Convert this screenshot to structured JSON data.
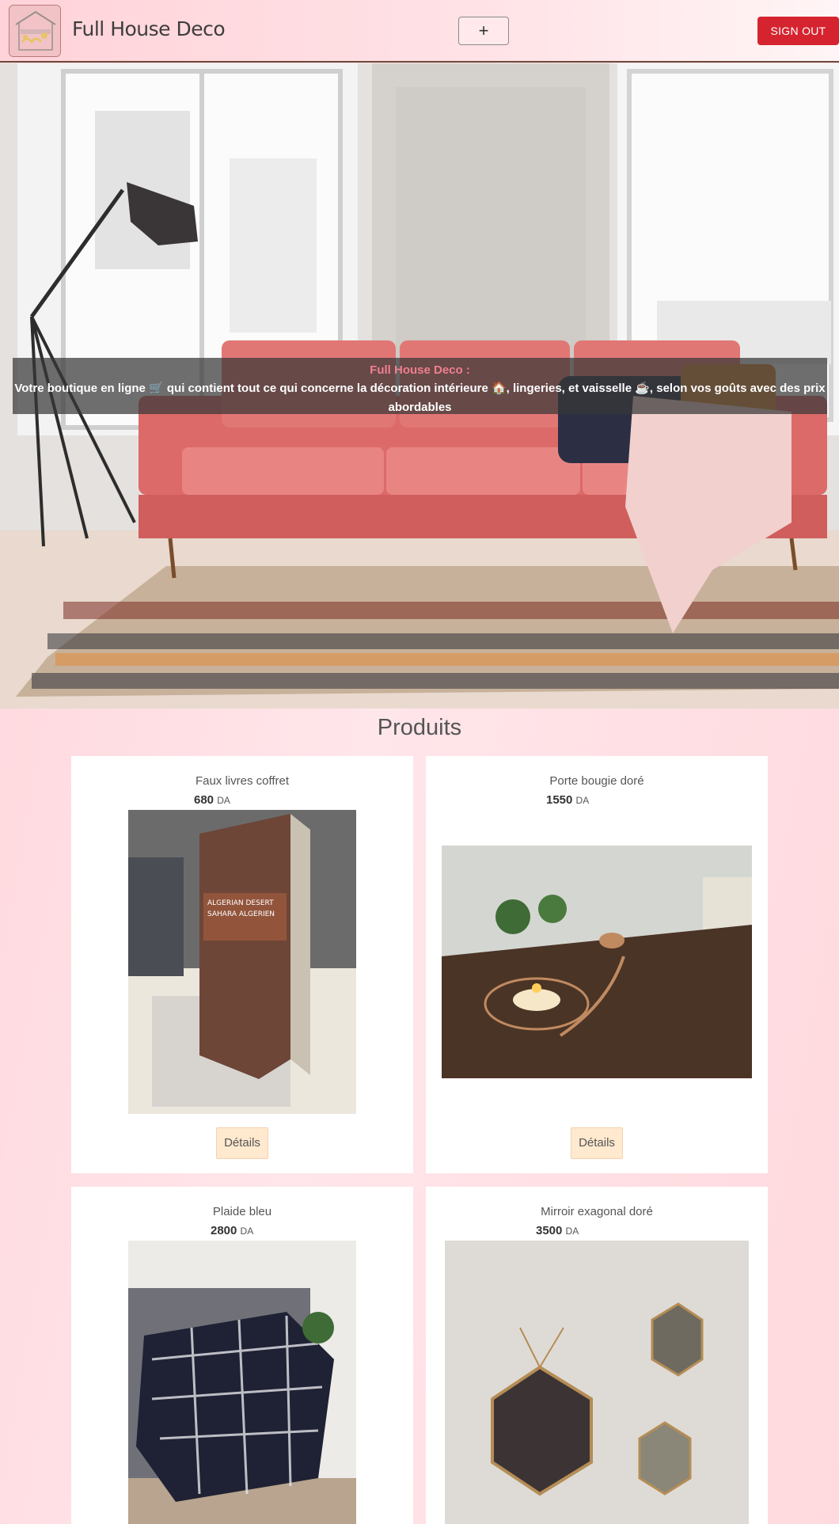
{
  "header": {
    "brand": "Full House Deco",
    "add_label": "+",
    "signout_label": "SIGN OUT"
  },
  "hero": {
    "title": "Full House Deco :",
    "text": "Votre boutique en ligne 🛒 qui contient tout ce qui concerne la décoration intérieure 🏠, lingeries, et vaisselle ☕, selon vos goûts avec des prix abordables"
  },
  "products": {
    "title": "Produits",
    "details_label": "Détails",
    "currency": "DA",
    "items": [
      {
        "name": "Faux livres coffret",
        "price": "680"
      },
      {
        "name": "Porte bougie doré",
        "price": "1550"
      },
      {
        "name": "Plaide bleu",
        "price": "2800"
      },
      {
        "name": "Mirroir exagonal doré",
        "price": "3500"
      }
    ]
  }
}
